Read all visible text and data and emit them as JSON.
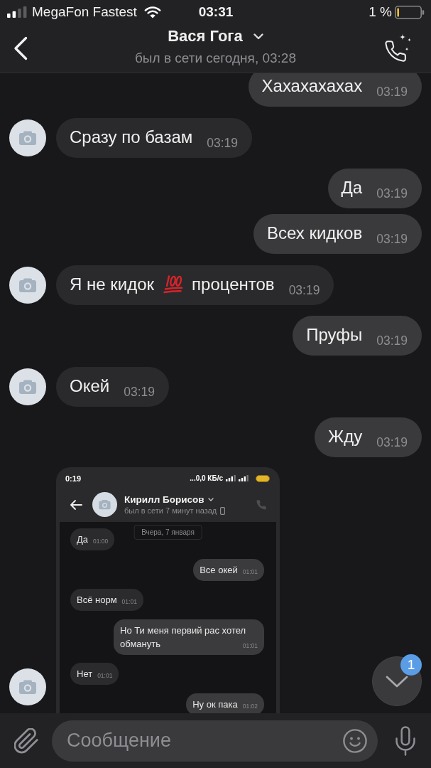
{
  "status_bar": {
    "carrier": "MegaFon Fastest",
    "time": "03:31",
    "battery": "1 %"
  },
  "header": {
    "title": "Вася Гога",
    "subtitle": "был в сети сегодня, 03:28"
  },
  "messages": [
    {
      "kind": "text",
      "outgoing": true,
      "text": "Хахахахахах",
      "time": "03:19"
    },
    {
      "kind": "text",
      "outgoing": false,
      "text": "Сразу по базам",
      "time": "03:19"
    },
    {
      "kind": "text",
      "outgoing": true,
      "text": "Да",
      "time": "03:19"
    },
    {
      "kind": "text",
      "outgoing": true,
      "text": "Всех кидков",
      "time": "03:19"
    },
    {
      "kind": "text",
      "outgoing": false,
      "segments": [
        {
          "kind": "text",
          "text": "Я не кидок"
        },
        {
          "kind": "emoji"
        },
        {
          "kind": "text",
          "text": "процентов"
        }
      ],
      "time": "03:19"
    },
    {
      "kind": "text",
      "outgoing": true,
      "text": "Пруфы",
      "time": "03:19"
    },
    {
      "kind": "text",
      "outgoing": false,
      "text": "Окей",
      "time": "03:19"
    },
    {
      "kind": "text",
      "outgoing": true,
      "text": "Жду",
      "time": "03:19"
    },
    {
      "kind": "screenshot",
      "outgoing": false,
      "screenshot": {
        "status_bar": {
          "time": "0:19",
          "speed": "...0,0 КБ/с"
        },
        "header": {
          "title": "Кирилл Борисов",
          "subtitle": "был в сети 7 минут назад"
        },
        "date": "Вчера, 7 января",
        "messages": [
          {
            "outgoing": false,
            "text": "Да",
            "time": "01:00"
          },
          {
            "outgoing": true,
            "text": "Все окей",
            "time": "01:01"
          },
          {
            "outgoing": false,
            "text": "Всё норм",
            "time": "01:01"
          },
          {
            "outgoing": true,
            "text": "Но Ти меня первий рас хотел обмануть",
            "time": "01:01"
          },
          {
            "outgoing": false,
            "text": "Нет",
            "time": "01:01"
          },
          {
            "outgoing": true,
            "text": "Ну ок пака",
            "time": "01:02"
          }
        ]
      }
    }
  ],
  "scroll_button": {
    "badge": "1"
  },
  "composer": {
    "placeholder": "Сообщение"
  }
}
